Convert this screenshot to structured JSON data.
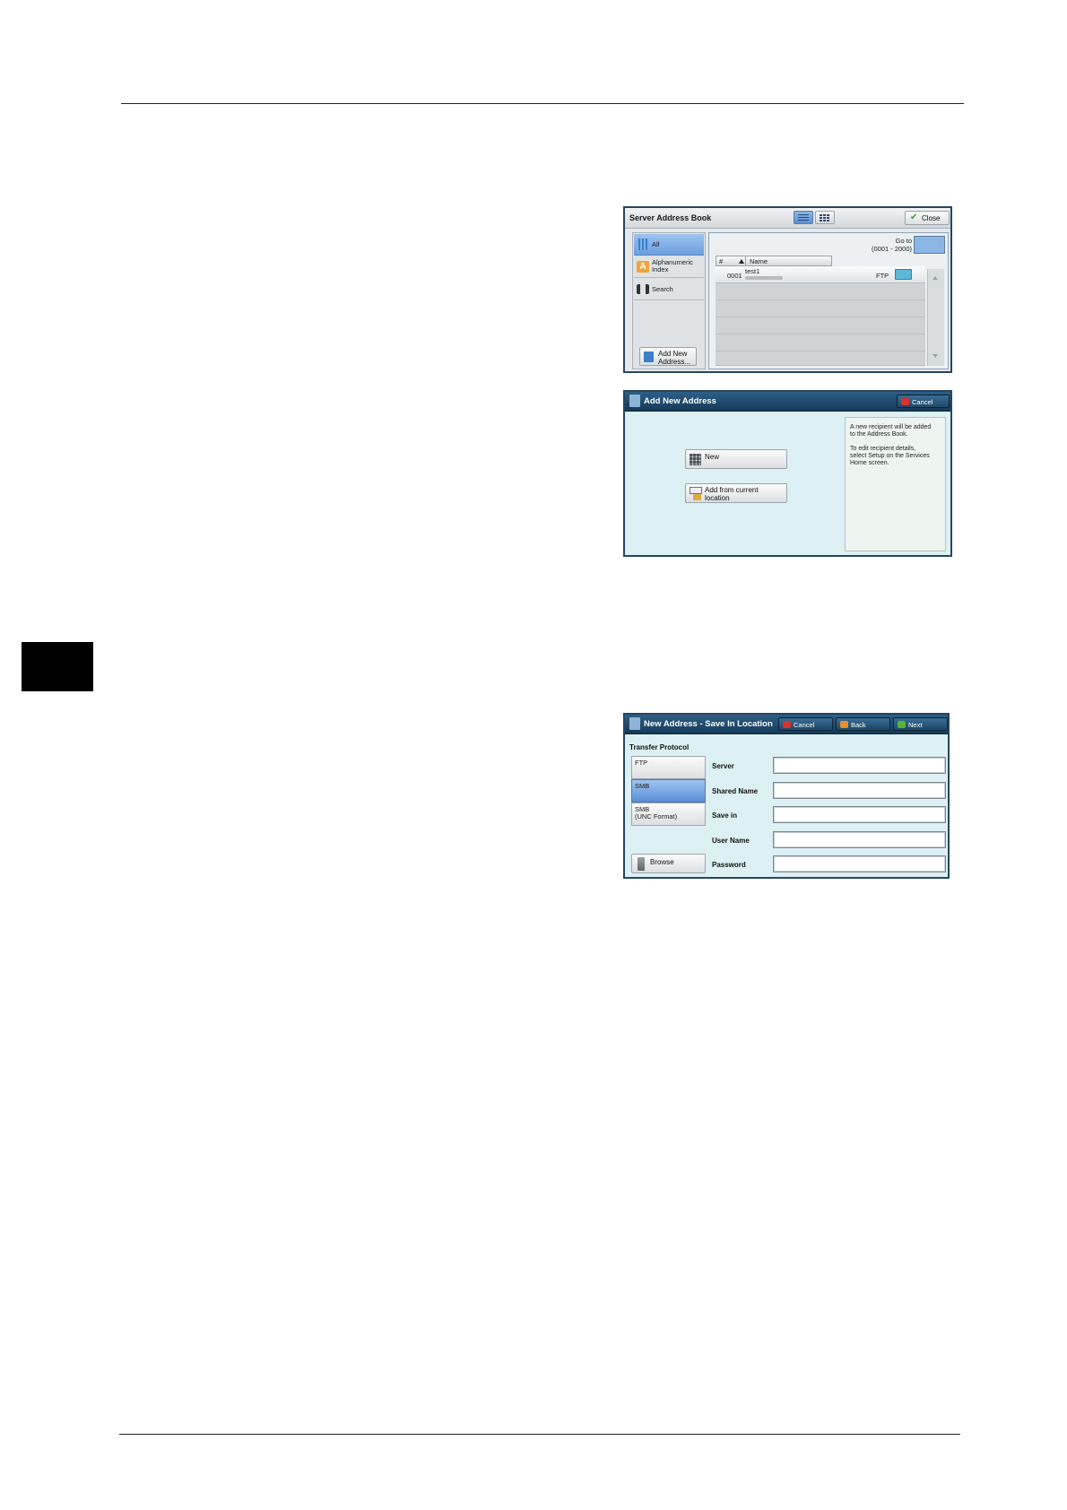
{
  "server_address_book": {
    "title": "Server Address Book",
    "close_label": "Close",
    "nav": {
      "all": "All",
      "alphanumeric_line1": "Alphanumeric",
      "alphanumeric_line2": "Index",
      "search": "Search"
    },
    "go_to_line1": "Go to",
    "go_to_line2": "(0001 - 2000)",
    "columns": {
      "number": "#",
      "name": "Name"
    },
    "rows": [
      {
        "number": "0001",
        "name": "test1",
        "type": "FTP"
      }
    ],
    "add_new_line1": "Add New",
    "add_new_line2": "Address..."
  },
  "add_new_address": {
    "title": "Add New Address",
    "cancel_label": "Cancel",
    "new_label": "New",
    "add_from_current_line1": "Add from current",
    "add_from_current_line2": "location",
    "info_line1": "A new recipient will be added",
    "info_line2": "to the Address Book.",
    "info_line3": "To edit recipient details,",
    "info_line4": "select Setup on the Services",
    "info_line5": "Home screen."
  },
  "save_in_location": {
    "title": "New Address - Save In Location",
    "cancel_label": "Cancel",
    "back_label": "Back",
    "next_label": "Next",
    "transfer_protocol": "Transfer Protocol",
    "protocols": {
      "ftp": "FTP",
      "smb": "SMB",
      "smb_unc_line1": "SMB",
      "smb_unc_line2": "(UNC Format)"
    },
    "browse_label": "Browse",
    "fields": {
      "server": "Server",
      "shared_name": "Shared Name",
      "save_in": "Save in",
      "user_name": "User Name",
      "password": "Password"
    }
  },
  "colors": {
    "accent_blue": "#5b8fd6",
    "dark_bar": "#1f4767",
    "panel_bg": "#ddf1f4"
  }
}
